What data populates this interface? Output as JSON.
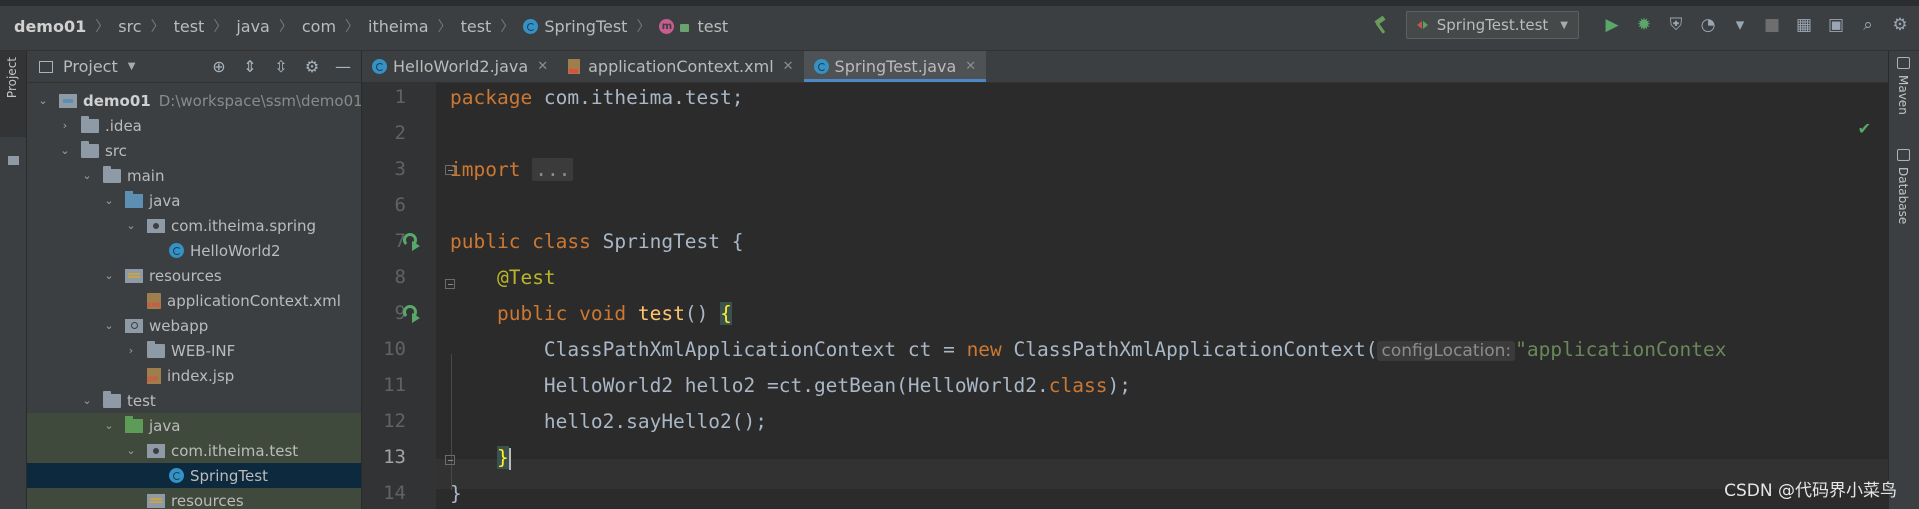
{
  "breadcrumb": {
    "items": [
      "demo01",
      "src",
      "test",
      "java",
      "com",
      "itheima",
      "test",
      "SpringTest",
      "test"
    ]
  },
  "run_config": {
    "label": "SpringTest.test"
  },
  "left_strip": {
    "project_tab": "Project"
  },
  "project_panel": {
    "title": "Project",
    "tree": [
      {
        "label": "demo01",
        "path": "D:\\workspace\\ssm\\demo01"
      },
      {
        "label": ".idea"
      },
      {
        "label": "src"
      },
      {
        "label": "main"
      },
      {
        "label": "java"
      },
      {
        "label": "com.itheima.spring"
      },
      {
        "label": "HelloWorld2"
      },
      {
        "label": "resources"
      },
      {
        "label": "applicationContext.xml"
      },
      {
        "label": "webapp"
      },
      {
        "label": "WEB-INF"
      },
      {
        "label": "index.jsp"
      },
      {
        "label": "test"
      },
      {
        "label": "java"
      },
      {
        "label": "com.itheima.test"
      },
      {
        "label": "SpringTest"
      },
      {
        "label": "resources"
      }
    ]
  },
  "tabs": [
    {
      "label": "HelloWorld2.java"
    },
    {
      "label": "applicationContext.xml"
    },
    {
      "label": "SpringTest.java",
      "active": true
    }
  ],
  "editor": {
    "line_numbers": [
      "1",
      "2",
      "3",
      "6",
      "7",
      "8",
      "9",
      "10",
      "11",
      "12",
      "13",
      "14"
    ],
    "current_line": "13",
    "code": {
      "l1_kw": "package",
      "l1_rest": " com.itheima.test;",
      "l3_kw": "import",
      "l3_fold": "...",
      "l7_kw": "public class",
      "l7_rest": " SpringTest {",
      "l8_ann": "@Test",
      "l9_kw": "public void",
      "l9_fn": "test",
      "l9_rest": "() ",
      "l9_brace": "{",
      "l10_a": "ClassPathXmlApplicationContext ct = ",
      "l10_kw": "new",
      "l10_b": " ClassPathXmlApplicationContext(",
      "l10_hint": "configLocation:",
      "l10_str": "\"applicationContex",
      "l11_a": "HelloWorld2 hello2 =ct.getBean(HelloWorld2.",
      "l11_kw": "class",
      "l11_b": ");",
      "l12": "hello2.sayHello2();",
      "l13": "}",
      "l14": "}"
    }
  },
  "right_strip": {
    "maven": "Maven",
    "database": "Database"
  },
  "watermark": "CSDN @代码界小菜鸟",
  "colors": {
    "keyword": "#cc7832",
    "annotation": "#bbb529",
    "function": "#ffc66d",
    "string": "#6a8759",
    "run_green": "#59a869"
  }
}
